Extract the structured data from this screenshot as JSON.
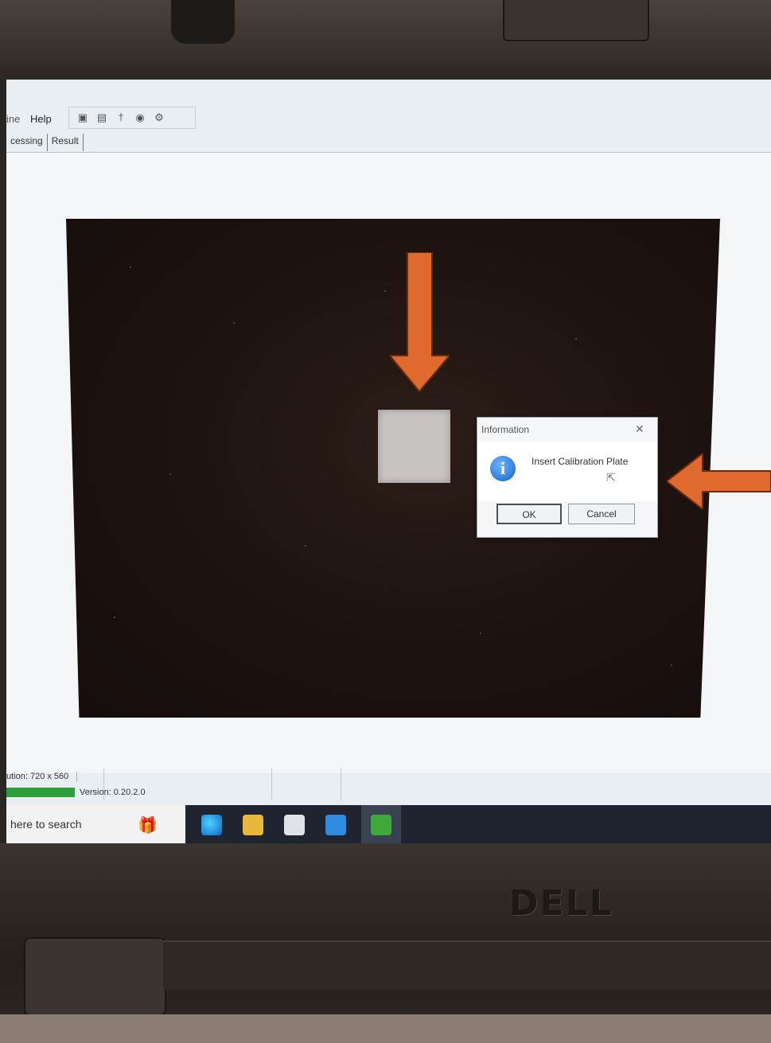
{
  "menu": {
    "partial_item": "ine",
    "help": "Help"
  },
  "toolbar": {
    "icons": [
      "camera-icon",
      "camera-alt-icon",
      "pin-icon",
      "globe-icon",
      "settings-icon"
    ]
  },
  "tabs": [
    {
      "label": "cessing"
    },
    {
      "label": "Result"
    }
  ],
  "dialog": {
    "title": "Information",
    "message": "Insert Calibration Plate",
    "ok_label": "OK",
    "cancel_label": "Cancel",
    "icon": "info-icon"
  },
  "statusbar": {
    "resolution": "ution: 720 x 560",
    "version": "Version: 0.20.2.0"
  },
  "taskbar": {
    "search_text": "here to search",
    "apps": [
      "edge-icon",
      "file-explorer-icon",
      "store-icon",
      "mail-icon",
      "app-icon"
    ]
  },
  "laptop": {
    "logo": "DELL"
  },
  "colors": {
    "annotation_arrow": "#e06a2e",
    "progress_green": "#2e9e3a"
  }
}
